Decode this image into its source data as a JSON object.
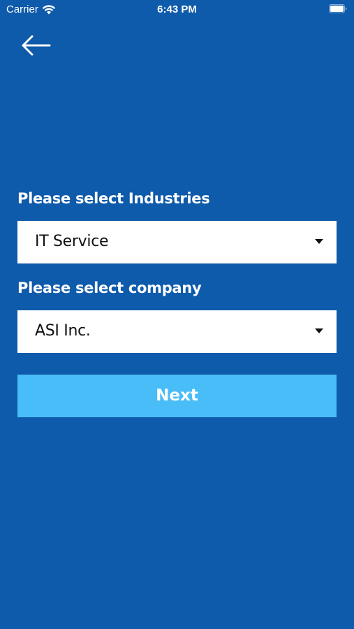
{
  "status_bar": {
    "carrier": "Carrier",
    "time": "6:43 PM",
    "wifi_icon": "wifi-icon",
    "battery_icon": "battery-icon"
  },
  "nav": {
    "back_icon": "arrow-left-icon"
  },
  "form": {
    "industries_label": "Please select Industries",
    "industries_value": "IT Service",
    "company_label": "Please select company",
    "company_value": "ASI Inc.",
    "dropdown_icon": "caret-down-icon",
    "next_label": "Next"
  },
  "colors": {
    "background": "#0e5aab",
    "button": "#49bdf7",
    "field": "#ffffff",
    "text_light": "#ffffff",
    "text_dark": "#111111"
  }
}
